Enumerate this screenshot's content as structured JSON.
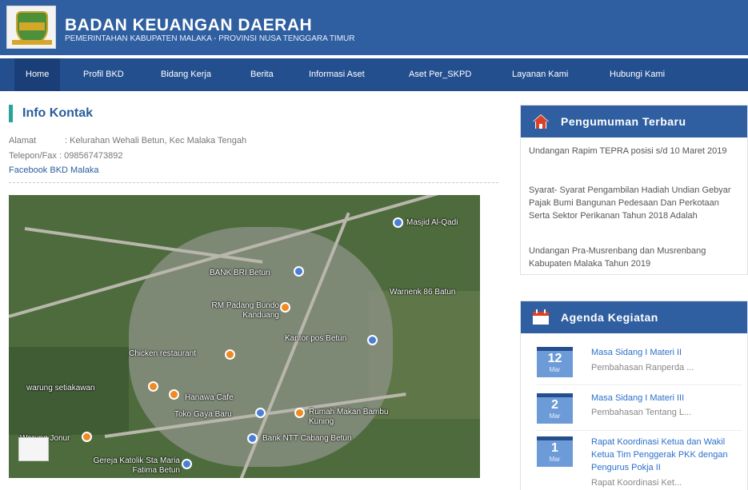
{
  "header": {
    "title": "BADAN KEUANGAN DAERAH",
    "subtitle": "PEMERINTAHAN KABUPATEN MALAKA - PROVINSI NUSA TENGGARA TIMUR"
  },
  "nav": {
    "items": [
      "Home",
      "Profil BKD",
      "Bidang Kerja",
      "Berita",
      "Informasi Aset",
      "Aset Per_SKPD",
      "Layanan Kami",
      "Hubungi Kami"
    ]
  },
  "contact": {
    "title": "Info Kontak",
    "address_label": "Alamat",
    "address_value": ": Kelurahan Wehali Betun, Kec Malaka Tengah",
    "phone": "Telepon/Fax : 098567473892",
    "facebook": "Facebook BKD Malaka"
  },
  "map": {
    "labels": [
      "Masjid Al-Qadi",
      "BANK BRI Betun",
      "Warnenk 86 Batun",
      "RM Padang Bundo Kanduang",
      "Kantor pos Betun",
      "Chicken restaurant",
      "warung setiakawan",
      "Hanawa Cafe",
      "Toko Gaya Baru",
      "Rumah Makan Bambu Kuning",
      "Bank NTT Cabang Betun",
      "Gereja Katolik Sta Maria Fatima Betun",
      "Warung Jonur"
    ]
  },
  "announcements": {
    "title": "Pengumuman Terbaru",
    "items": [
      "Undangan Rapim TEPRA posisi s/d 10 Maret 2019",
      "Syarat- Syarat Pengambilan Hadiah Undian Gebyar Pajak Bumi Bangunan Pedesaan Dan Perkotaan Serta Sektor Perikanan Tahun 2018 Adalah",
      "Undangan Pra-Musrenbang dan Musrenbang Kabupaten Malaka Tahun 2019"
    ]
  },
  "agenda": {
    "title": "Agenda Kegiatan",
    "items": [
      {
        "day": "12",
        "month": "Mar",
        "title": "Masa Sidang I Materi II",
        "desc": "Pembahasan Ranperda ..."
      },
      {
        "day": "2",
        "month": "Mar",
        "title": "Masa Sidang I Materi III",
        "desc": "Pembahasan Tentang L..."
      },
      {
        "day": "1",
        "month": "Mar",
        "title": "Rapat Koordinasi Ketua dan Wakil Ketua Tim Penggerak PKK dengan Pengurus Pokja II",
        "desc": "Rapat Koordinasi Ket..."
      }
    ]
  },
  "colors": {
    "header": "#2f5fa0",
    "nav": "#244f8f",
    "accent": "#2aa39a",
    "link": "#2b6fcb"
  }
}
